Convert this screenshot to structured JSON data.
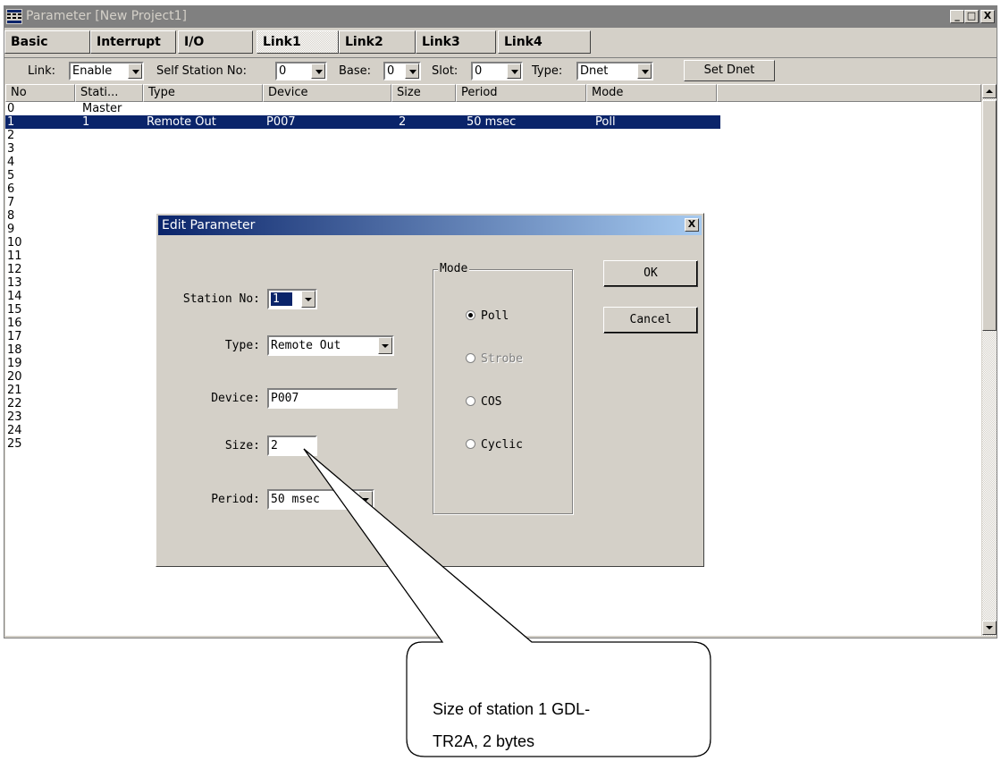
{
  "window": {
    "title": "Parameter [New Project1]",
    "minimize": "_",
    "maximize": "□",
    "close": "X"
  },
  "tabs": [
    "Basic",
    "Interrupt",
    "I/O",
    "Link1",
    "Link2",
    "Link3",
    "Link4"
  ],
  "active_tab": "Link1",
  "toolbar": {
    "link_label": "Link:",
    "link_value": "Enable",
    "self_station_label": "Self Station No:",
    "self_station_value": "0",
    "base_label": "Base:",
    "base_value": "0",
    "slot_label": "Slot:",
    "slot_value": "0",
    "type_label": "Type:",
    "type_value": "Dnet",
    "set_dnet_label": "Set Dnet"
  },
  "table": {
    "columns": [
      "No",
      "Stati...",
      "Type",
      "Device",
      "Size",
      "Period",
      "Mode"
    ],
    "rows": [
      {
        "no": "0",
        "station": "Master",
        "type": "",
        "device": "",
        "size": "",
        "period": "",
        "mode": ""
      },
      {
        "no": "1",
        "station": "1",
        "type": "Remote Out",
        "device": "P007",
        "size": "2",
        "period": "50 msec",
        "mode": "Poll"
      },
      {
        "no": "2"
      },
      {
        "no": "3"
      },
      {
        "no": "4"
      },
      {
        "no": "5"
      },
      {
        "no": "6"
      },
      {
        "no": "7"
      },
      {
        "no": "8"
      },
      {
        "no": "9"
      },
      {
        "no": "10"
      },
      {
        "no": "11"
      },
      {
        "no": "12"
      },
      {
        "no": "13"
      },
      {
        "no": "14"
      },
      {
        "no": "15"
      },
      {
        "no": "16"
      },
      {
        "no": "17"
      },
      {
        "no": "18"
      },
      {
        "no": "19"
      },
      {
        "no": "20"
      },
      {
        "no": "21"
      },
      {
        "no": "22"
      },
      {
        "no": "23"
      },
      {
        "no": "24"
      },
      {
        "no": "25"
      }
    ],
    "selected_row": 1
  },
  "dialog": {
    "title": "Edit Parameter",
    "close": "X",
    "station_no_label": "Station No:",
    "station_no_value": "1",
    "type_label": "Type:",
    "type_value": "Remote Out",
    "device_label": "Device:",
    "device_value": "P007",
    "size_label": "Size:",
    "size_value": "2",
    "period_label": "Period:",
    "period_value": "50 msec",
    "mode_group_label": "Mode",
    "modes": [
      {
        "label": "Poll",
        "checked": true,
        "disabled": false
      },
      {
        "label": "Strobe",
        "checked": false,
        "disabled": true
      },
      {
        "label": "COS",
        "checked": false,
        "disabled": false
      },
      {
        "label": "Cyclic",
        "checked": false,
        "disabled": false
      }
    ],
    "ok_label": "OK",
    "cancel_label": "Cancel"
  },
  "callout": {
    "line1": "Size of station 1 GDL-",
    "line2": "TR2A, 2 bytes"
  },
  "colors": {
    "selection": "#0a246a",
    "face": "#d4d0c8",
    "title_inactive": "#808080"
  }
}
